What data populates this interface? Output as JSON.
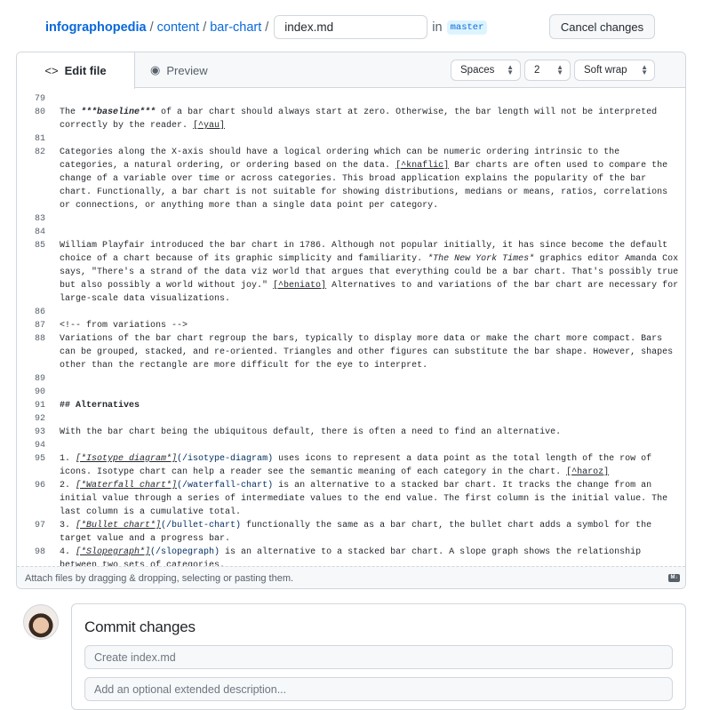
{
  "breadcrumb": {
    "repo": "infographopedia",
    "folder1": "content",
    "folder2": "bar-chart",
    "separator": "/",
    "filename": "index.md",
    "in_label": "in",
    "branch": "master"
  },
  "cancel_label": "Cancel changes",
  "tabs": {
    "edit": "Edit file",
    "preview": "Preview"
  },
  "settings": {
    "indent_mode": "Spaces",
    "indent_size": "2",
    "wrap_mode": "Soft wrap"
  },
  "code_lines": [
    {
      "n": "79",
      "segs": []
    },
    {
      "n": "80",
      "segs": [
        {
          "t": "The ",
          "s": ""
        },
        {
          "t": "***baseline***",
          "s": "b"
        },
        {
          "t": " of a bar chart should always start at zero. Otherwise, the bar length will not be interpreted correctly by the reader. ",
          "s": ""
        },
        {
          "t": "[^yau]",
          "s": "u"
        }
      ]
    },
    {
      "n": "81",
      "segs": []
    },
    {
      "n": "82",
      "segs": [
        {
          "t": "Categories along the X-axis should have a logical ordering which can be numeric ordering intrinsic to the categories, a natural ordering, or ordering based on the data. ",
          "s": ""
        },
        {
          "t": "[^knaflic]",
          "s": "u"
        },
        {
          "t": " Bar charts are often used to compare the change of a variable over time or across categories. This broad application explains the popularity of the bar chart. Functionally, a bar chart is not suitable for showing distributions, medians or means, ratios, correlations or connections, or anything more than a single data point per category.",
          "s": ""
        }
      ]
    },
    {
      "n": "83",
      "segs": []
    },
    {
      "n": "84",
      "segs": []
    },
    {
      "n": "85",
      "segs": [
        {
          "t": "William Playfair introduced the bar chart in 1786. Although not popular initially, it has since become the default choice of a chart because of its graphic simplicity and familiarity. ",
          "s": ""
        },
        {
          "t": "*The New York Times*",
          "s": "i"
        },
        {
          "t": " graphics editor Amanda Cox says, \"There's a strand of the data viz world that argues that everything could be a bar chart. That's possibly true but also possibly a world without joy.\" ",
          "s": ""
        },
        {
          "t": "[^beniato]",
          "s": "u"
        },
        {
          "t": " Alternatives to and variations of the bar chart are necessary for large-scale data visualizations.",
          "s": ""
        }
      ]
    },
    {
      "n": "86",
      "segs": []
    },
    {
      "n": "87",
      "segs": [
        {
          "t": "<!-- from variations -->",
          "s": ""
        }
      ]
    },
    {
      "n": "88",
      "segs": [
        {
          "t": "Variations of the bar chart regroup the bars, typically to display more data or make the chart more compact. Bars can be grouped, stacked, and re-oriented. Triangles and other figures can substitute the bar shape. However, shapes other than the rectangle are more difficult for the eye to interpret.",
          "s": ""
        }
      ]
    },
    {
      "n": "89",
      "segs": []
    },
    {
      "n": "90",
      "segs": []
    },
    {
      "n": "91",
      "segs": [
        {
          "t": "## Alternatives",
          "s": "h"
        }
      ]
    },
    {
      "n": "92",
      "segs": []
    },
    {
      "n": "93",
      "segs": [
        {
          "t": "With the bar chart being the ubiquitous default, there is often a need to find an alternative.",
          "s": ""
        }
      ]
    },
    {
      "n": "94",
      "segs": []
    },
    {
      "n": "95",
      "segs": [
        {
          "t": "1. ",
          "s": ""
        },
        {
          "t": "[*Isotype diagram*]",
          "s": "lt"
        },
        {
          "t": "(/isotype-diagram)",
          "s": "url"
        },
        {
          "t": " uses icons to represent a data point as the total length of the row of icons. Isotype chart can help a reader see the semantic meaning of each category in the chart. ",
          "s": ""
        },
        {
          "t": "[^haroz]",
          "s": "u"
        }
      ]
    },
    {
      "n": "96",
      "segs": [
        {
          "t": "2. ",
          "s": ""
        },
        {
          "t": "[*Waterfall chart*]",
          "s": "lt"
        },
        {
          "t": "(/waterfall-chart)",
          "s": "url"
        },
        {
          "t": " is an alternative to a stacked bar chart. It tracks the change from an initial value through a series of intermediate values to the end value. The first column is the initial value. The last column is a cumulative total.",
          "s": ""
        }
      ]
    },
    {
      "n": "97",
      "segs": [
        {
          "t": "3. ",
          "s": ""
        },
        {
          "t": "[*Bullet chart*]",
          "s": "lt"
        },
        {
          "t": "(/bullet-chart)",
          "s": "url"
        },
        {
          "t": " functionally the same as a bar chart, the bullet chart adds a symbol for the target value and a progress bar.",
          "s": ""
        }
      ]
    },
    {
      "n": "98",
      "segs": [
        {
          "t": "4. ",
          "s": ""
        },
        {
          "t": "[*Slopegraph*]",
          "s": "lt"
        },
        {
          "t": "(/slopegraph)",
          "s": "url"
        },
        {
          "t": " is an alternative to a stacked bar chart. A slope graph shows the relationship between two sets of categories.",
          "s": ""
        }
      ]
    }
  ],
  "footer": {
    "attach_text": "Attach files by dragging & dropping, selecting or pasting them.",
    "markdown_badge": "M↓"
  },
  "commit": {
    "title": "Commit changes",
    "summary_placeholder": "Create index.md",
    "description_placeholder": "Add an optional extended description..."
  }
}
